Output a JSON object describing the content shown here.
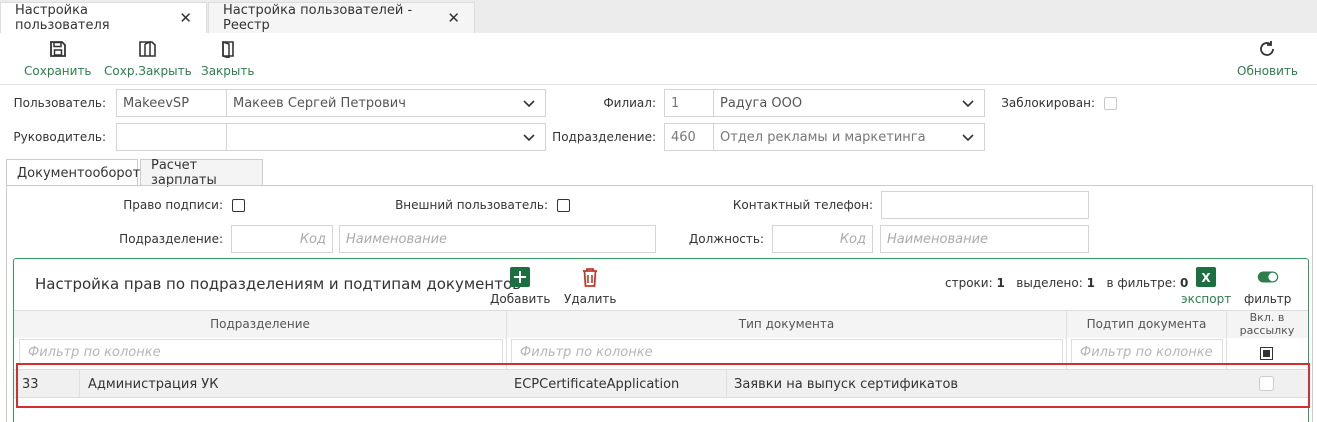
{
  "tabs": [
    {
      "label": "Настройка пользователя"
    },
    {
      "label": "Настройка пользователей - Реестр"
    }
  ],
  "toolbar": {
    "save": "Сохранить",
    "save_close": "Сохр.Закрыть",
    "close": "Закрыть",
    "refresh": "Обновить"
  },
  "form": {
    "user_label": "Пользователь:",
    "user_login": "MakeevSP",
    "user_name": "Макеев Сергей Петрович",
    "manager_label": "Руководитель:",
    "manager_login": "",
    "manager_name": "",
    "branch_label": "Филиал:",
    "branch_code": "1",
    "branch_name": "Радуга ООО",
    "division_label": "Подразделение:",
    "division_code": "460",
    "division_name": "Отдел рекламы и маркетинга",
    "blocked_label": "Заблокирован:"
  },
  "inner_tabs": [
    {
      "label": "Документооборот"
    },
    {
      "label": "Расчет зарплаты"
    }
  ],
  "docflow": {
    "sign_right_label": "Право подписи:",
    "external_user_label": "Внешний пользователь:",
    "contact_phone_label": "Контактный телефон:",
    "contact_phone_value": "",
    "division_label": "Подразделение:",
    "division_code_placeholder": "Код",
    "division_name_placeholder": "Наименование",
    "position_label": "Должность:",
    "position_code_placeholder": "Код",
    "position_name_placeholder": "Наименование"
  },
  "grid": {
    "title": "Настройка прав по подразделениям и подтипам документов",
    "add_label": "Добавить",
    "delete_label": "Удалить",
    "rows_label": "строки:",
    "rows_value": "1",
    "selected_label": "выделено:",
    "selected_value": "1",
    "in_filter_label": "в фильтре:",
    "in_filter_value": "0",
    "export_label": "экспорт",
    "filter_label": "фильтр",
    "columns": {
      "division": "Подразделение",
      "doc_type": "Тип документа",
      "doc_subtype": "Подтип документа",
      "mailing": "Вкл. в рассылку"
    },
    "filter_placeholder": "Фильтр по колонке",
    "rows": [
      {
        "division_code": "33",
        "division_name": "Администрация УК",
        "doc_type_code": "ECPCertificateApplication",
        "doc_type_name": "Заявки на выпуск сертификатов",
        "doc_subtype": "",
        "mailing": false
      }
    ]
  },
  "colors": {
    "accent_green": "#2e7d4a",
    "excel_green": "#1d6f42",
    "delete_red": "#c0392b",
    "highlight_red": "#d32f2f"
  }
}
